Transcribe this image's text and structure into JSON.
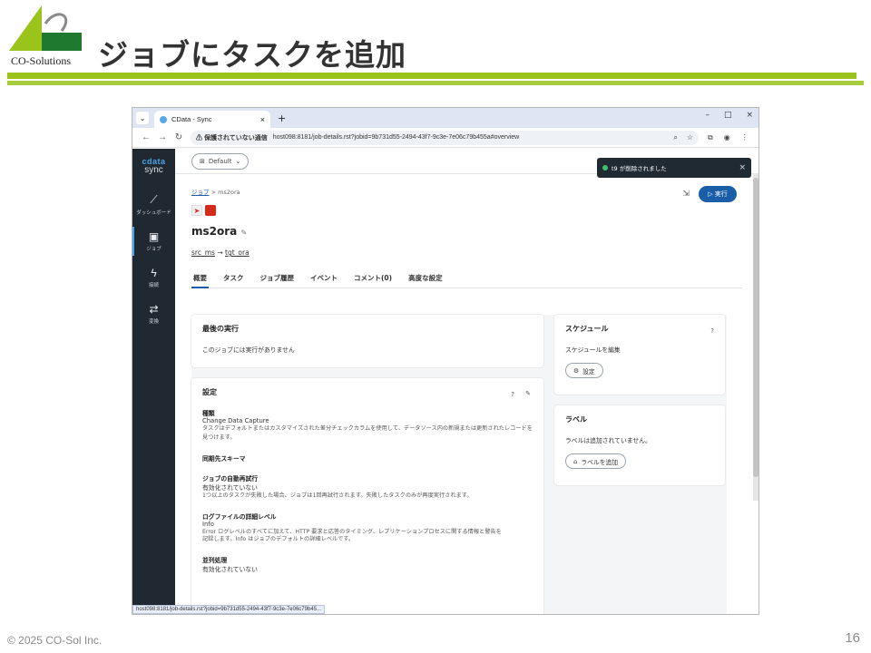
{
  "slide": {
    "title": "ジョブにタスクを追加",
    "logo_text": "CO-Solutions",
    "footer": "© 2025 CO-Sol Inc.",
    "page_number": "16",
    "accent_color": "#9ac31c"
  },
  "browser": {
    "tab_title": "CData - Sync",
    "tab_close": "×",
    "new_tab": "+",
    "window_controls": [
      "–",
      "□",
      "×"
    ],
    "security_warning": "⚠ 保護されていない通信",
    "url": "host098:8181/job-details.rst?jobid=9b731d55-2494-43f7-9c3e-7e06c79b455a#overview",
    "status_url": "host098:8181/job-details.rst?jobid=9b731d55-2494-43f7-9c3e-7e06c79b45..."
  },
  "sidebar": {
    "brand_top": "cdata",
    "brand_bottom": "sync",
    "items": [
      {
        "label": "ダッシュボード",
        "icon": "chart-icon"
      },
      {
        "label": "ジョブ",
        "icon": "briefcase-icon"
      },
      {
        "label": "接続",
        "icon": "bolt-icon"
      },
      {
        "label": "変換",
        "icon": "transform-icon"
      }
    ]
  },
  "header": {
    "workspace": "Default",
    "toast": "t9 が削除されました"
  },
  "job": {
    "breadcrumb_root": "ジョブ",
    "breadcrumb_sep": ">",
    "breadcrumb_current": "ms2ora",
    "name": "ms2ora",
    "source": "src_ms",
    "arrow": "→",
    "destination": "tgt_ora",
    "run_label": "▷ 実行"
  },
  "tabs": [
    "概要",
    "タスク",
    "ジョブ履歴",
    "イベント",
    "コメント(0)",
    "高度な設定"
  ],
  "last_run": {
    "title": "最後の実行",
    "text": "このジョブには実行がありません"
  },
  "settings": {
    "title": "設定",
    "type_label": "種類",
    "type_value": "Change Data Capture",
    "type_desc": "タスクはデフォルトまたはカスタマイズされた差分チェックカラムを使用して、データソース内の新規または更新されたレコードを見つけます。",
    "schema_label": "同期先スキーマ",
    "retry_label": "ジョブの自動再試行",
    "retry_value": "有効化されていない",
    "retry_desc": "1つ以上のタスクが失敗した場合、ジョブは1回再試行されます。失敗したタスクのみが再度実行されます。",
    "log_label": "ログファイルの詳細レベル",
    "log_value": "Info",
    "log_desc1": "Error ログレベルのすべてに加えて、HTTP 要求と応答のタイミング、レプリケーションプロセスに関する情報と警告を",
    "log_desc2": "記録します。Info はジョブのデフォルトの詳細レベルです。",
    "parallel_label": "並列処理",
    "parallel_value": "有効化されていない"
  },
  "schedule": {
    "title": "スケジュール",
    "text": "スケジュールを編集",
    "button": "設定"
  },
  "labels": {
    "title": "ラベル",
    "text": "ラベルは追加されていません。",
    "button": "ラベルを追加"
  }
}
